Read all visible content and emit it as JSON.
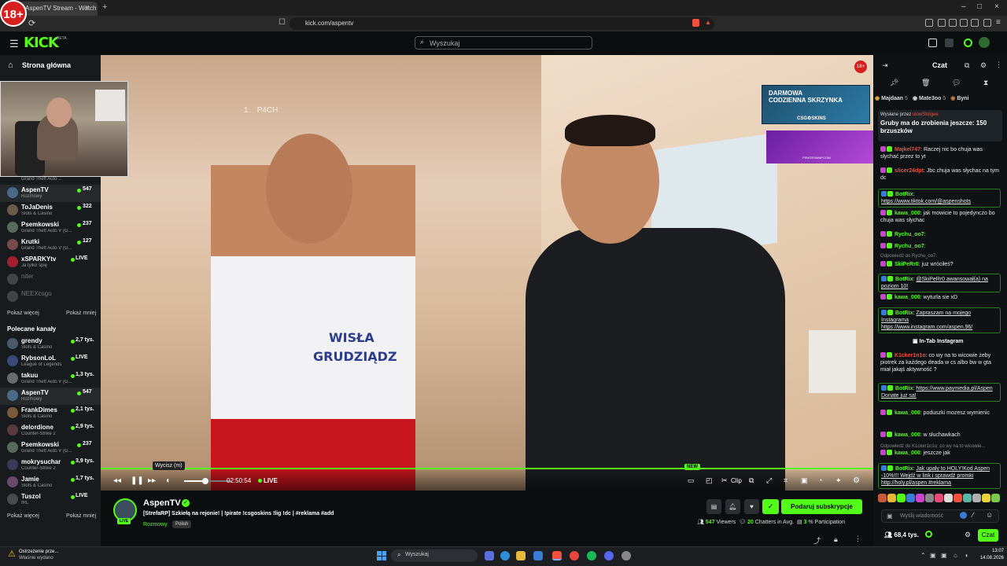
{
  "browser": {
    "age_badge": "18+",
    "tab_title": "AspenTV Stream - Watch Live",
    "url": "kick.com/aspentv",
    "new_tab": "+",
    "tab_close": "×",
    "win_min": "–",
    "win_max": "□",
    "win_close": "×"
  },
  "header": {
    "logo": "KICK",
    "beta": "BETA",
    "search_placeholder": "Wyszukaj"
  },
  "sidebar": {
    "home": "Strona główna",
    "following": [
      {
        "name": "AspenTV",
        "category": "Rozmowy",
        "count": "547",
        "live": true,
        "active": true,
        "color": "#4a6a8a"
      },
      {
        "name": "ToJaDenis",
        "category": "Slots & Casino",
        "count": "322",
        "live": true,
        "color": "#6a5a4a"
      },
      {
        "name": "Psemkowski",
        "category": "Grand Theft Auto V (G...",
        "count": "237",
        "live": true,
        "color": "#5a6a5a"
      },
      {
        "name": "Krutki",
        "category": "Grand Theft Auto V (G...",
        "count": "127",
        "live": true,
        "color": "#7a4a4a"
      },
      {
        "name": "xSPARKYtv",
        "category": "Ja tylko śpię",
        "count": "LIVE",
        "live": true,
        "color": "#a02030"
      },
      {
        "name": "niter",
        "category": "",
        "count": "",
        "live": false,
        "color": "#444"
      },
      {
        "name": "NEEXcsgo",
        "category": "",
        "count": "",
        "live": false,
        "color": "#444"
      }
    ],
    "above_first_category": "Grand Theft Auto ...",
    "show_more": "Pokaż więcej",
    "show_less": "Pokaż mniej",
    "recommended_header": "Polecane kanały",
    "recommended": [
      {
        "name": "grendy",
        "category": "Slots & Casino",
        "count": "2,7 tys.",
        "color": "#4a5a6a"
      },
      {
        "name": "RybsonLoL",
        "category": "League of Legends",
        "count": "LIVE",
        "color": "#3a4a7a"
      },
      {
        "name": "takuu",
        "category": "Grand Theft Auto V (G...",
        "count": "1,3 tys.",
        "color": "#6a6a6a"
      },
      {
        "name": "AspenTV",
        "category": "Rozmowy",
        "count": "547",
        "active": true,
        "color": "#4a6a8a"
      },
      {
        "name": "FrankDimes",
        "category": "Slots & Casino",
        "count": "2,1 tys.",
        "color": "#7a5a3a"
      },
      {
        "name": "delordione",
        "category": "Counter-Strike 2",
        "count": "2,9 tys.",
        "color": "#5a3a3a"
      },
      {
        "name": "Psemkowski",
        "category": "Grand Theft Auto V (G...",
        "count": "237",
        "color": "#5a6a5a"
      },
      {
        "name": "mokrysuchar",
        "category": "Counter-Strike 2",
        "count": "3,9 tys.",
        "color": "#3a3a5a"
      },
      {
        "name": "Jamie",
        "category": "Slots & Casino",
        "count": "1,7 tys.",
        "color": "#6a4a6a"
      },
      {
        "name": "Tuszol",
        "category": "IRL",
        "count": "LIVE",
        "color": "#4a4a4a"
      }
    ]
  },
  "video": {
    "overlay_rank": "1.",
    "overlay_name": "P4CH",
    "age": "18+",
    "ad1_line1": "DARMOWA",
    "ad1_line2": "CODZIENNA SKRZYNKA",
    "ad1_brand": "CSG⚙SKINS",
    "ad2_brand": "PIRATESWAP.COM",
    "shirt_line1": "WISŁA",
    "shirt_line2": "GRUDZIĄDZ",
    "progress": 1.0
  },
  "player": {
    "tooltip": "Wycisz (m)",
    "time": "02:50:54",
    "live": "LIVE",
    "volume": 0.45,
    "new_badge": "NEW",
    "clip": "Clip"
  },
  "stream": {
    "streamer": "AspenTV",
    "title": "[StrefaRP] Szkiełą na rejonie! | !pirate !csgoskins !lig !dc | #reklama #add",
    "category": "Rozmowy",
    "language": "Polish",
    "live": "LIVE",
    "subscribe": "Podaruj subskrypcje",
    "viewers_num": "547",
    "viewers_label": "Viewers",
    "chatters_num": "20",
    "chatters_label": "Chatters in Avg.",
    "participation_num": "3",
    "participation_label": "% Participation"
  },
  "chat": {
    "title": "Czat",
    "leaders": [
      {
        "name": "Majdaan",
        "count": "5"
      },
      {
        "name": "Mate3oo",
        "count": "5"
      },
      {
        "name": "Byni",
        "count": ""
      }
    ],
    "pinned_by_label": "Wysłane przez",
    "pinned_by": "ulowStolgee",
    "pinned_msg": "Gruby ma do zrobienia jeszcze: 150 brzuszków",
    "messages": [
      {
        "user": "Majkel747",
        "color": "#f0503c",
        "text": "Raczej nic bo chuja was słychać przez to yt"
      },
      {
        "user": "slicer24dpt",
        "color": "#f0503c",
        "text": "Jbc chuja was słychac na tym dc"
      },
      {
        "user": "BotRix",
        "color": "#53fc18",
        "text": "https://www.tiktok.com/@aspenshots",
        "bot": true
      },
      {
        "user": "kawa_000",
        "color": "#53fc18",
        "text": "jak mowicie to pojedynczo bo chuja was słychac"
      },
      {
        "user": "Rychu_oo7",
        "color": "#53fc18",
        "text": ""
      },
      {
        "user": "Rychu_oo7",
        "color": "#53fc18",
        "text": ""
      },
      {
        "user": "SkiPeRr0",
        "color": "#53fc18",
        "text": "juz wróciłeś?"
      },
      {
        "user": "BotRix",
        "color": "#53fc18",
        "text": "@SkiPeRr0 awansował(a) na poziom 10!",
        "bot": true
      },
      {
        "user": "kawa_000",
        "color": "#53fc18",
        "text": "wyturla sie xD"
      },
      {
        "user": "BotRix",
        "color": "#53fc18",
        "text": "Zapraszam na mojego Instagrama https://www.instagram.com/aspen.96/",
        "bot": true
      },
      {
        "user": "K1cker1n1o",
        "color": "#f0503c",
        "text": "co wy na to wicowie żeby piotrek za każdego deada w cs albo bw w gta miał jakąś aktywność ?"
      },
      {
        "user": "BotRix",
        "color": "#53fc18",
        "text": "https://www.paymedia.pl/Aspen Donate juz sa!",
        "bot": true
      },
      {
        "user": "kawa_000",
        "color": "#53fc18",
        "text": "poduszki mozesz wymienic"
      },
      {
        "user": "kawa_000",
        "color": "#53fc18",
        "text": "w słuchawkach"
      },
      {
        "user": "kawa_000",
        "color": "#53fc18",
        "text": "jeszcze jak"
      },
      {
        "user": "BotRix",
        "color": "#53fc18",
        "text": "Jak upały to HOLY!Kod Aspen -10%!!! Wejdź w link i sprawdź promki http://holy.pl/aspen #reklama",
        "bot": true
      }
    ],
    "reply1": "Odpowiedź do Rychu_oo7:",
    "reply2": "Odpowiedź do K1cker1n1o: co wy na to wicowie...",
    "intab": "In-Tab Instagram",
    "input_placeholder": "Wyślij wiadomość",
    "viewers": "68,4 tys.",
    "send": "Czat"
  },
  "taskbar": {
    "alert_title": "Ostrzeżenie prze...",
    "alert_sub": "Właśnie wydano",
    "search": "Wyszukaj",
    "time": "13:07",
    "date": "14.08.2026"
  }
}
